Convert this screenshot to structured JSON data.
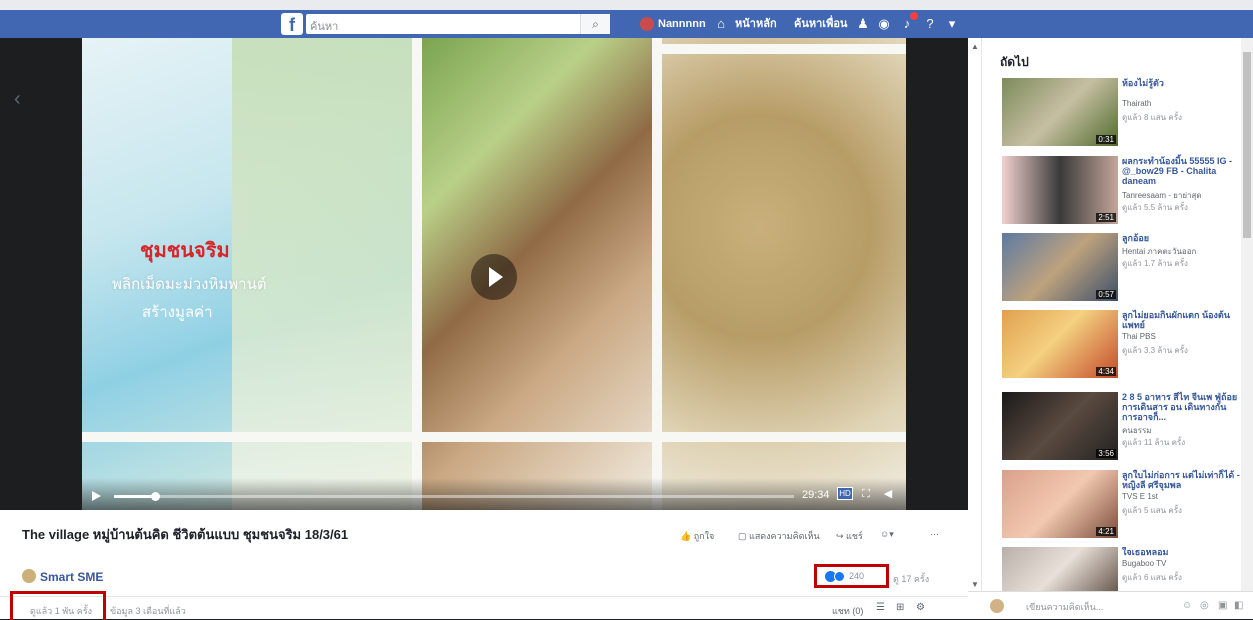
{
  "topbar": {
    "logo": "f",
    "search_placeholder": "ค้นหา",
    "user_name": "Nannnnn",
    "nav_home": "หน้าหลัก",
    "nav_find_friends": "ค้นหาเพื่อน"
  },
  "video": {
    "overlay_title": "ชุมชนจริม",
    "overlay_line1": "พลิกเม็ดมะม่วงหิมพานต์",
    "overlay_line2": "สร้างมูลค่า",
    "time": "29:34",
    "hd_label": "HD",
    "progress": 0.06
  },
  "info": {
    "title": "The village หมู่บ้านต้นคิด ชีวิตต้นแบบ ชุมชนจริม 18/3/61",
    "page_name": "Smart SME",
    "action_like": "ถูกใจ",
    "action_comment": "แสดงความคิดเห็น",
    "action_share": "แชร์",
    "action_more": "···",
    "reactions_count": "240",
    "views": "ดู 17 ครั้ง",
    "stats_left": "ดูแล้ว 1 พัน ครั้ง",
    "stats_right": "ข้อมูล 3 เดือนที่แล้ว",
    "sort_label": "แชท (0)"
  },
  "sidebar": {
    "header": "ถัดไป",
    "items": [
      {
        "title": "ห้องไม่รู้ตัว",
        "channel": "Thairath",
        "views": "ดูแล้ว 8 แสน ครั้ง",
        "duration": "0:31"
      },
      {
        "title": "ผลกระทำน้องมิ้น 55555 IG - @_bow29 FB - Chalita daneam",
        "channel": "Tanreesaam - ยาย่าสุด",
        "views": "ดูแล้ว 5.5 ล้าน ครั้ง",
        "duration": "2:51"
      },
      {
        "title": "ลูกอ้อย",
        "channel": "Hentai ภาคตะวันออก",
        "views": "ดูแล้ว 1.7 ล้าน ครั้ง",
        "duration": "0:57"
      },
      {
        "title": "ลูกไม่ยอมกินผักแตก น้องต้นแพทย์",
        "channel": "Thai PBS",
        "views": "ดูแล้ว 3.3 ล้าน ครั้ง",
        "duration": "4:34"
      },
      {
        "title": "2 8 5 อาหาร สีไท จีนเพ ฟู่ถ้อยการเดินสาร อน เดินทางกันการอาจก็...",
        "channel": "คนธรรม",
        "views": "ดูแล้ว 11 ล้าน ครั้ง",
        "duration": "3:56"
      },
      {
        "title": "ลูกใบไม่ก่อการ แต่ไม่เท่าก็ได้ - หญิงลี ศรีจุมพล",
        "channel": "TVS E 1st",
        "views": "ดูแล้ว 5 แสน ครั้ง",
        "duration": "4:21"
      },
      {
        "title": "ใจเธอหลอม",
        "channel": "Bugaboo TV",
        "views": "ดูแล้ว 6 แสน ครั้ง",
        "duration": ""
      }
    ],
    "compose_placeholder": "เขียนความคิดเห็น..."
  },
  "colors": {
    "fb_blue": "#4267b2",
    "highlight_red": "#c00000",
    "overlay_red": "#d7262a"
  }
}
